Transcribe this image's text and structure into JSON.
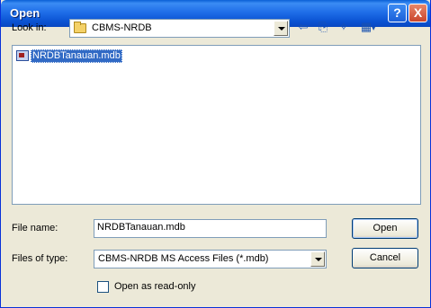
{
  "window": {
    "title": "Open"
  },
  "titlebar": {
    "help_glyph": "?",
    "close_glyph": "X"
  },
  "lookin": {
    "label": "Look in:",
    "value": "CBMS-NRDB"
  },
  "toolbar": {
    "back_glyph": "⇦",
    "up_glyph": "⎘",
    "newfolder_glyph": "✧",
    "views_glyph": "▦"
  },
  "files": [
    {
      "name": "NRDBTanauan.mdb",
      "selected": true
    }
  ],
  "filename": {
    "label": "File name:",
    "value": "NRDBTanauan.mdb"
  },
  "filetype": {
    "label": "Files of type:",
    "value": "CBMS-NRDB MS Access Files (*.mdb)"
  },
  "buttons": {
    "open": "Open",
    "cancel": "Cancel"
  },
  "readonly": {
    "label": "Open as read-only",
    "checked": false
  },
  "colors": {
    "title_bar": "#0a52d2",
    "selection": "#316ac5",
    "dialog_bg": "#ece9d8"
  }
}
